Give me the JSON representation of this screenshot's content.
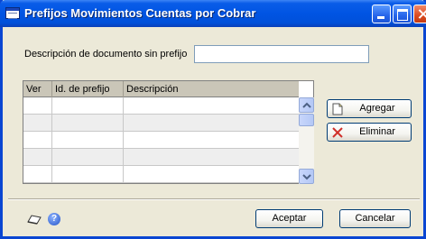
{
  "window": {
    "title": "Prefijos Movimientos Cuentas por Cobrar"
  },
  "form": {
    "description_label": "Descripción de documento sin prefijo",
    "description_value": ""
  },
  "grid": {
    "columns": [
      "Ver",
      "Id. de prefijo",
      "Descripción"
    ],
    "rows": [
      {
        "ver": "",
        "id": "",
        "desc": ""
      },
      {
        "ver": "",
        "id": "",
        "desc": ""
      },
      {
        "ver": "",
        "id": "",
        "desc": ""
      },
      {
        "ver": "",
        "id": "",
        "desc": ""
      },
      {
        "ver": "",
        "id": "",
        "desc": ""
      }
    ]
  },
  "buttons": {
    "add": "Agregar",
    "delete": "Eliminar",
    "accept": "Aceptar",
    "cancel": "Cancelar"
  },
  "icons": {
    "window": "window-app-icon",
    "add": "new-document-icon",
    "delete": "red-x-icon",
    "note": "note-icon",
    "help": "help-icon"
  },
  "colors": {
    "titlebar": "#0054e3",
    "window_bg": "#ece9d8",
    "delete_x": "#d0302a"
  }
}
